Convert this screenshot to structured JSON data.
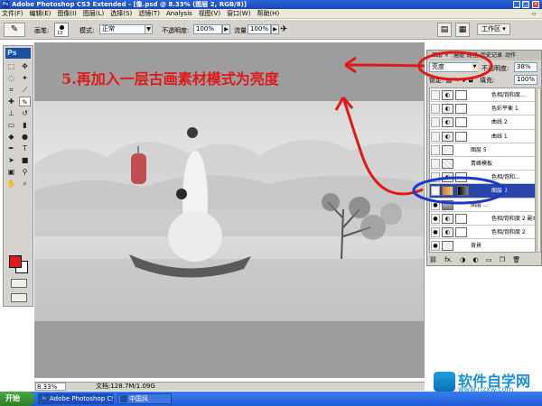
{
  "window": {
    "title": "Adobe Photoshop CS3 Extended - [像.psd @ 8.33% (图层 2, RGB/8)]",
    "app_icon": "Ps",
    "controls": [
      "minimize-icon",
      "maximize-icon",
      "close-icon"
    ]
  },
  "menubar": {
    "items": [
      "文件(F)",
      "编辑(E)",
      "图像(I)",
      "图层(L)",
      "选择(S)",
      "滤镜(T)",
      "Analysis",
      "视图(V)",
      "窗口(W)",
      "帮助(H)"
    ]
  },
  "options": {
    "brush_label": "画笔:",
    "brush_size": "13",
    "mode_label": "模式:",
    "mode_value": "正常",
    "opacity_label": "不透明度:",
    "opacity_value": "100%",
    "flow_label": "流量:",
    "flow_value": "100%",
    "workspace_label": "工作区 ▾"
  },
  "toolbox": {
    "logo": "Ps",
    "fg_color": "#e01818",
    "bg_color": "#ffffff"
  },
  "annotation": {
    "text": "5.再加入一层古画素材模式为亮度",
    "color": "#e01818"
  },
  "status": {
    "zoom": "8.33%",
    "doc": "文档:128.7M/1.09G"
  },
  "layers_panel": {
    "tabs": [
      "图层 ×",
      "通道",
      "路径",
      "历史记录",
      "动作"
    ],
    "blend_mode": "亮度",
    "opacity_label": "不透明度:",
    "opacity": "38%",
    "lock_label": "锁定:",
    "fill_label": "填充:",
    "fill": "100%",
    "layers": [
      {
        "name": "色相/饱和度...",
        "visible": false
      },
      {
        "name": "色彩平衡 1",
        "visible": false
      },
      {
        "name": "曲线 2",
        "visible": false
      },
      {
        "name": "曲线 1",
        "visible": false
      },
      {
        "name": "图层 5",
        "visible": false
      },
      {
        "name": "青峰模板",
        "visible": false
      },
      {
        "name": "色相/饱和...",
        "visible": false
      },
      {
        "name": "图层 2",
        "visible": true,
        "selected": true
      },
      {
        "name": "图层 ...",
        "visible": true
      },
      {
        "name": "色相/饱和度 2 副本 3",
        "visible": true
      },
      {
        "name": "色相/饱和度 2",
        "visible": true
      },
      {
        "name": "背景",
        "visible": true
      }
    ],
    "footer_icons": [
      "link-icon",
      "fx-icon",
      "mask-icon",
      "adjustment-icon",
      "folder-icon",
      "new-layer-icon",
      "trash-icon"
    ]
  },
  "taskbar": {
    "start": "开始",
    "tasks": [
      "Adobe Photoshop CS3 E...",
      "中国风"
    ]
  },
  "watermark": {
    "brand": "软件自学网",
    "url": "www.rjzxw.com"
  }
}
